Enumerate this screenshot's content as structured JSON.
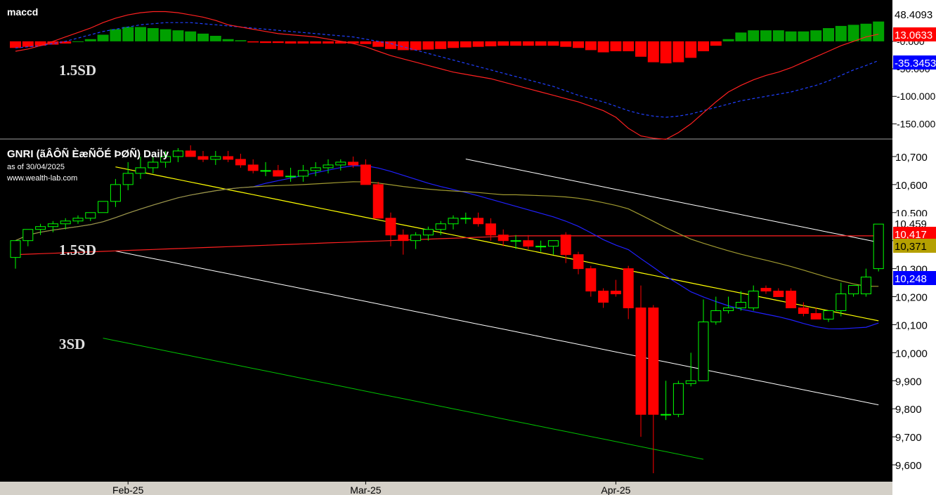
{
  "macd_panel": {
    "title": "maccd",
    "sd_label": "1.5SD",
    "yticks": [
      "-0.000",
      "-50.000",
      "-100.000",
      "-150.000"
    ],
    "badges": [
      {
        "text": "48.4093",
        "value": 48.4093,
        "bg": "#ffffff",
        "fg": "#000000"
      },
      {
        "text": "13.0633",
        "value": 13.0633,
        "bg": "#ff0000",
        "fg": "#ffffff"
      },
      {
        "text": "-35.3453",
        "value": -35.3453,
        "bg": "#0000ff",
        "fg": "#ffffff"
      }
    ]
  },
  "price_panel": {
    "title": "GNRI (ãÂÔÑ ÈæÑÕÉ ÞØÑ) Daily",
    "as_of": "as of 30/04/2025",
    "site": "www.wealth-lab.com",
    "sd_labels": [
      "1.5SD",
      "3SD"
    ],
    "yticks": [
      "10,700",
      "10,600",
      "10,500",
      "10,400",
      "10,300",
      "10,200",
      "10,100",
      "10,000",
      "9,900",
      "9,800",
      "9,700",
      "9,600"
    ],
    "badges": [
      {
        "text": "10,459",
        "value": 10459,
        "bg": "#ffffff",
        "fg": "#000000"
      },
      {
        "text": "10,417",
        "value": 10417,
        "bg": "#ff0000",
        "fg": "#ffffff"
      },
      {
        "text": "10,371",
        "value": 10371,
        "bg": "#b5a000",
        "fg": "#000000"
      },
      {
        "text": "10,248",
        "value": 10248,
        "bg": "#0000ff",
        "fg": "#ffffff"
      }
    ]
  },
  "x_axis": {
    "labels": [
      {
        "text": "Feb-25",
        "index": 9
      },
      {
        "text": "Mar-25",
        "index": 28
      },
      {
        "text": "Apr-25",
        "index": 48
      }
    ]
  },
  "colors": {
    "up": "#00ff00",
    "down": "#ff0000",
    "hist_up": "#00a000",
    "hist_down": "#ff0000",
    "regression": "#ffff00",
    "channel_1_5": "#ffffff",
    "channel_3": "#00c000",
    "ma_red": "#ff2020",
    "ma_blue": "#2020ff",
    "ma_olive": "#a09a30",
    "macd_line": "#ff2020",
    "signal_line": "#2040ff"
  },
  "chart_data": [
    {
      "type": "bar",
      "name": "maccd",
      "ylim": [
        -175,
        70
      ],
      "x": [
        0,
        1,
        2,
        3,
        4,
        5,
        6,
        7,
        8,
        9,
        10,
        11,
        12,
        13,
        14,
        15,
        16,
        17,
        18,
        19,
        20,
        21,
        22,
        23,
        24,
        25,
        26,
        27,
        28,
        29,
        30,
        31,
        32,
        33,
        34,
        35,
        36,
        37,
        38,
        39,
        40,
        41,
        42,
        43,
        44,
        45,
        46,
        47,
        48,
        49,
        50,
        51,
        52,
        53,
        54,
        55,
        56,
        57,
        58,
        59,
        60,
        61,
        62,
        63,
        64,
        65,
        66,
        67,
        68,
        69
      ],
      "histogram": [
        -12,
        -10,
        -8,
        -6,
        -4,
        0,
        4,
        12,
        22,
        26,
        26,
        24,
        22,
        20,
        18,
        14,
        10,
        4,
        2,
        -2,
        -3,
        -3,
        -4,
        -4,
        -4,
        -4,
        -4,
        -4,
        -5,
        -10,
        -14,
        -16,
        -16,
        -15,
        -14,
        -12,
        -11,
        -10,
        -9,
        -8,
        -8,
        -8,
        -8,
        -8,
        -10,
        -12,
        -16,
        -20,
        -18,
        -18,
        -28,
        -38,
        -40,
        -38,
        -30,
        -18,
        -8,
        4,
        16,
        20,
        20,
        20,
        18,
        18,
        20,
        24,
        28,
        30,
        32,
        36
      ],
      "macd": [
        -18,
        -14,
        -8,
        0,
        8,
        16,
        24,
        34,
        42,
        48,
        52,
        54,
        54,
        52,
        48,
        44,
        38,
        30,
        26,
        22,
        18,
        14,
        12,
        10,
        8,
        4,
        0,
        -4,
        -10,
        -18,
        -26,
        -32,
        -38,
        -44,
        -50,
        -56,
        -60,
        -64,
        -68,
        -74,
        -80,
        -86,
        -92,
        -98,
        -104,
        -110,
        -118,
        -126,
        -138,
        -158,
        -172,
        -176,
        -178,
        -166,
        -150,
        -130,
        -110,
        -92,
        -80,
        -70,
        -62,
        -56,
        -48,
        -38,
        -28,
        -18,
        -8,
        0,
        8,
        13
      ],
      "signal": [
        -12,
        -10,
        -8,
        -4,
        0,
        6,
        12,
        18,
        22,
        26,
        30,
        32,
        34,
        34,
        34,
        32,
        30,
        28,
        26,
        24,
        22,
        20,
        18,
        16,
        14,
        12,
        10,
        8,
        4,
        0,
        -4,
        -10,
        -16,
        -22,
        -28,
        -34,
        -40,
        -46,
        -52,
        -58,
        -64,
        -70,
        -76,
        -82,
        -90,
        -98,
        -104,
        -110,
        -118,
        -126,
        -132,
        -136,
        -138,
        -136,
        -132,
        -126,
        -120,
        -114,
        -108,
        -104,
        -100,
        -96,
        -92,
        -86,
        -80,
        -72,
        -62,
        -52,
        -44,
        -35
      ]
    },
    {
      "type": "candlestick",
      "name": "GNRI Daily",
      "ylim": [
        9540,
        10760
      ],
      "x": [
        0,
        1,
        2,
        3,
        4,
        5,
        6,
        7,
        8,
        9,
        10,
        11,
        12,
        13,
        14,
        15,
        16,
        17,
        18,
        19,
        20,
        21,
        22,
        23,
        24,
        25,
        26,
        27,
        28,
        29,
        30,
        31,
        32,
        33,
        34,
        35,
        36,
        37,
        38,
        39,
        40,
        41,
        42,
        43,
        44,
        45,
        46,
        47,
        48,
        49,
        50,
        51,
        52,
        53,
        54,
        55,
        56,
        57,
        58,
        59,
        60,
        61,
        62,
        63,
        64,
        65,
        66,
        67,
        68,
        69
      ],
      "open": [
        10340,
        10400,
        10440,
        10450,
        10460,
        10470,
        10480,
        10500,
        10540,
        10600,
        10640,
        10660,
        10680,
        10700,
        10720,
        10700,
        10690,
        10700,
        10690,
        10670,
        10650,
        10650,
        10630,
        10630,
        10650,
        10660,
        10670,
        10680,
        10670,
        10600,
        10480,
        10420,
        10400,
        10420,
        10440,
        10460,
        10480,
        10480,
        10460,
        10420,
        10400,
        10400,
        10380,
        10380,
        10420,
        10350,
        10300,
        10220,
        10220,
        10300,
        10160,
        10160,
        9780,
        9780,
        9890,
        9900,
        10110,
        10150,
        10160,
        10160,
        10230,
        10220,
        10220,
        10160,
        10140,
        10120,
        10150,
        10210,
        10210,
        10300
      ],
      "high": [
        10380,
        10440,
        10460,
        10470,
        10480,
        10490,
        10500,
        10540,
        10620,
        10680,
        10700,
        10700,
        10720,
        10730,
        10740,
        10720,
        10720,
        10720,
        10710,
        10690,
        10680,
        10670,
        10660,
        10670,
        10680,
        10690,
        10690,
        10700,
        10690,
        10610,
        10500,
        10440,
        10430,
        10450,
        10470,
        10490,
        10500,
        10500,
        10480,
        10440,
        10420,
        10420,
        10400,
        10400,
        10430,
        10360,
        10310,
        10230,
        10260,
        10310,
        10240,
        10170,
        9900,
        9900,
        10000,
        10190,
        10200,
        10200,
        10220,
        10240,
        10240,
        10230,
        10230,
        10180,
        10160,
        10130,
        10250,
        10240,
        10300,
        10330
      ],
      "low": [
        10300,
        10380,
        10420,
        10430,
        10440,
        10460,
        10470,
        10500,
        10520,
        10580,
        10620,
        10640,
        10660,
        10680,
        10700,
        10680,
        10670,
        10680,
        10660,
        10640,
        10630,
        10630,
        10610,
        10610,
        10630,
        10640,
        10650,
        10660,
        10600,
        10480,
        10380,
        10350,
        10370,
        10400,
        10420,
        10440,
        10460,
        10450,
        10400,
        10380,
        10370,
        10370,
        10360,
        10350,
        10320,
        10280,
        10200,
        10160,
        10200,
        10120,
        9700,
        9570,
        9760,
        9770,
        9880,
        9900,
        10100,
        10140,
        10150,
        10150,
        10210,
        10200,
        10190,
        10130,
        10120,
        10110,
        10130,
        10200,
        10200,
        10290
      ],
      "close": [
        10400,
        10440,
        10450,
        10460,
        10470,
        10480,
        10500,
        10540,
        10600,
        10640,
        10660,
        10680,
        10700,
        10720,
        10700,
        10690,
        10700,
        10690,
        10670,
        10650,
        10650,
        10630,
        10630,
        10650,
        10660,
        10670,
        10680,
        10670,
        10600,
        10480,
        10420,
        10400,
        10420,
        10440,
        10460,
        10480,
        10480,
        10460,
        10420,
        10400,
        10400,
        10380,
        10380,
        10400,
        10350,
        10300,
        10220,
        10180,
        10210,
        10160,
        9780,
        9780,
        9780,
        9890,
        9900,
        10110,
        10150,
        10160,
        10180,
        10220,
        10220,
        10200,
        10160,
        10140,
        10120,
        10150,
        10210,
        10240,
        10270,
        10459
      ]
    }
  ]
}
